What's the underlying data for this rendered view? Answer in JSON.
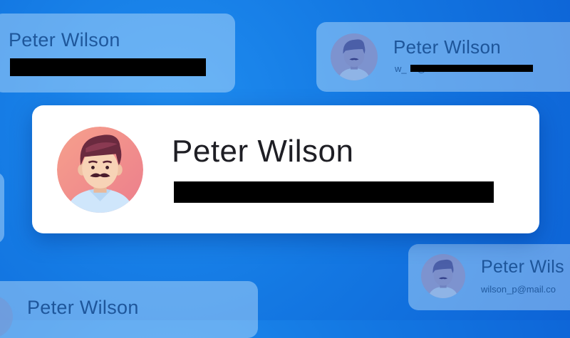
{
  "main_card": {
    "name": "Peter Wilson",
    "email_redacted": true
  },
  "ghost_cards": [
    {
      "name": "Peter Wilson",
      "email_redacted": true
    },
    {
      "name": "Peter Wilson",
      "email": "w_  @b           il.com"
    },
    {
      "name": "Peter Wils",
      "email": "wilson_p@mail.co"
    },
    {
      "name": "Peter Wilson"
    }
  ],
  "colors": {
    "background": "#1479e3",
    "card_main": "#ffffff",
    "avatar_warm": "#f08a86",
    "hair": "#6a2a3f"
  }
}
